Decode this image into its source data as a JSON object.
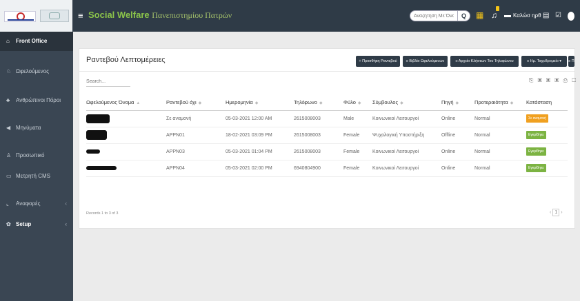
{
  "header": {
    "brand_main": "Social Welfare",
    "brand_sub": "Πανεπιστημίου Πατρών",
    "search_placeholder": "Αναζήτηση Με Όνομα ή Ι",
    "user_label": "Καλώσ ηρθ",
    "icons": [
      "hamburger-icon",
      "search-icon",
      "grid-icon",
      "bell-icon",
      "bed-icon",
      "calendar-icon",
      "check-icon",
      "settings-icon"
    ],
    "colors": {
      "topbar": "#2f3b47",
      "brand": "#8bc34a",
      "icon_accent": "#f5c518"
    }
  },
  "sidebar": {
    "items": [
      {
        "label": "Front Office",
        "icon": "home-icon"
      },
      {
        "label": "Ωφελούμενος",
        "icon": "users-icon"
      },
      {
        "label": "Ανθρώπινοι Πόροι",
        "icon": "people-icon"
      },
      {
        "label": "Μηνύματα",
        "icon": "message-icon"
      },
      {
        "label": "Προσωπικό",
        "icon": "person-icon"
      },
      {
        "label": "Μετρητή CMS",
        "icon": "desktop-icon"
      },
      {
        "label": "Αναφορές",
        "icon": "chart-icon"
      },
      {
        "label": "Setup",
        "icon": "cogs-icon"
      }
    ]
  },
  "panel": {
    "title": "Ραντεβού Λεπτομέρειες",
    "buttons": [
      "+ Προσθήκη Ραντεβού",
      "≡ Βιβλίο Ωφελούμενων",
      "≡ Αρχείο Κλήσεων Του Τηλεφώνου",
      "≡ Ημ. Ταχυδρομείο ▾",
      "≡ Παράπονα"
    ],
    "search_placeholder": "Search...",
    "export_tools": "⎘ ▣ ▣ ▣ ⎙ ☐",
    "columns": [
      "Ωφελούμενος Όνομα",
      "Ραντεβού όχι",
      "Ημερομηνία",
      "Τηλέφωνο",
      "Φύλο",
      "Σύμβουλος",
      "Πηγή",
      "Προτεραιότητα",
      "Κατάσταση"
    ],
    "rows": [
      {
        "appointment": "Σε αναμονή",
        "date": "05-03-2021 12:00 AM",
        "phone": "2615008003",
        "gender": "Male",
        "counsellor": "Κοινωνικοί Λειτουργοί",
        "source": "Online",
        "priority": "Normal",
        "status": "Σε αναμονή"
      },
      {
        "appointment": "APPN01",
        "date": "18-02-2021 03:09 PM",
        "phone": "2615008003",
        "gender": "Female",
        "counsellor": "Ψυχολογική Υποστήριξη",
        "source": "Offline",
        "priority": "Normal",
        "status": "Εγκρίθηκε"
      },
      {
        "appointment": "APPN03",
        "date": "05-03-2021 01:04 PM",
        "phone": "2615008003",
        "gender": "Female",
        "counsellor": "Κοινωνικοί Λειτουργοί",
        "source": "Online",
        "priority": "Normal",
        "status": "Εγκρίθηκε"
      },
      {
        "appointment": "APPN04",
        "date": "05-03-2021 02:00 PM",
        "phone": "6940804900",
        "gender": "Female",
        "counsellor": "Κοινωνικοί Λειτουργοί",
        "source": "Online",
        "priority": "Normal",
        "status": "Εγκρίθηκε"
      }
    ],
    "status_colors": {
      "pending": "#f0a020",
      "approved": "#7cb342"
    },
    "records_info": "Records 1 to 3 of 3",
    "pager": {
      "prev": "‹",
      "page": "1",
      "next": "›"
    }
  }
}
